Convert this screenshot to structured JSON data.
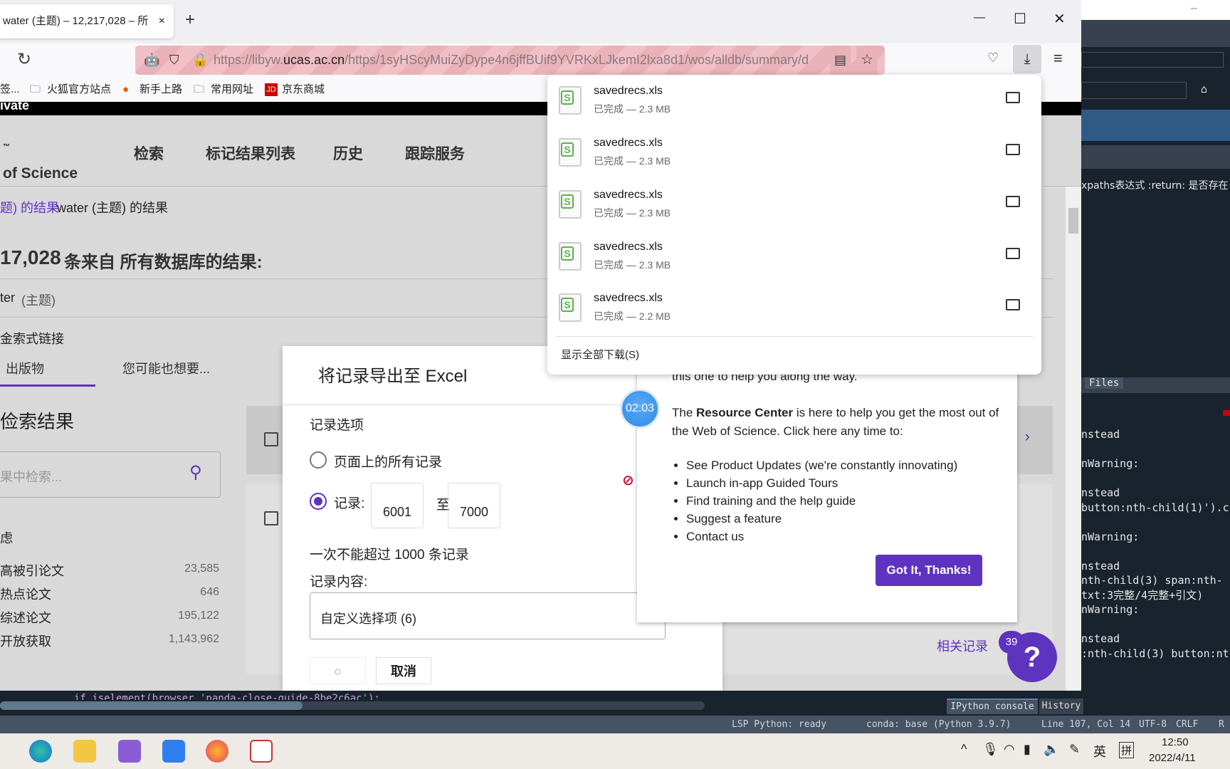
{
  "browser": {
    "tab_title": "water (主题) – 12,217,028 – 所",
    "tab_close": "×",
    "new_tab": "+",
    "url_prefix": "https://libyw.",
    "url_domain": "ucas.ac.cn",
    "url_rest": "/https/1syHScyMuiZyDype4n6jffBUif9YVRKxLJkemI2lxa8d1/wos/alldb/summary/d",
    "bookmarks": [
      "签...",
      "火狐官方站点",
      "新手上路",
      "常用网址",
      "京东商城"
    ],
    "window_controls": [
      "—",
      "☐",
      "✕"
    ]
  },
  "wos": {
    "banner_text": "ivate",
    "logo": "of Science",
    "logo_tm": "™",
    "nav": [
      "检索",
      "标记结果列表",
      "历史",
      "跟踪服务"
    ],
    "breadcrumb_link": "题) 的结果",
    "breadcrumb_current": "water (主题) 的结果",
    "results_count": "17,028",
    "results_text": "条来自 所有数据库的结果:",
    "query": "ter",
    "query_field": "(主题)",
    "query_link_label": "金索式链接",
    "tabs": [
      "出版物",
      "您可能也想要..."
    ],
    "section_title": "俭索结果",
    "search_placeholder": "果中检索...",
    "filter_heading": "虑",
    "filters": [
      {
        "label": "高被引论文",
        "count": "23,585"
      },
      {
        "label": "热点论文",
        "count": "646"
      },
      {
        "label": "综述论文",
        "count": "195,122"
      },
      {
        "label": "开放获取",
        "count": "1,143,962"
      }
    ],
    "related_records": "相关记录"
  },
  "export_modal": {
    "title": "将记录导出至 Excel",
    "record_options": "记录选项",
    "option_all": "页面上的所有记录",
    "option_range": "记录:",
    "from": "6001",
    "to_label": "至",
    "to": "7000",
    "limit_note": "一次不能超过 1000 条记录",
    "content_label": "记录内容:",
    "content_value": "自定义选择项 (6)",
    "cancel": "取消"
  },
  "downloads": {
    "items": [
      {
        "name": "savedrecs.xls",
        "status": "已完成 — 2.3 MB"
      },
      {
        "name": "savedrecs.xls",
        "status": "已完成 — 2.3 MB"
      },
      {
        "name": "savedrecs.xls",
        "status": "已完成 — 2.3 MB"
      },
      {
        "name": "savedrecs.xls",
        "status": "已完成 — 2.3 MB"
      },
      {
        "name": "savedrecs.xls",
        "status": "已完成 — 2.2 MB"
      }
    ],
    "show_all": "显示全部下载(S)"
  },
  "resource_center": {
    "timer": "02:03",
    "intro": "this one to help you along the way.",
    "p1_pre": "The ",
    "p1_bold": "Resource Center",
    "p1_post": " is here to help you get the most out of",
    "p2": "the Web of Science. Click here any time to:",
    "bullets": [
      "See Product Updates (we're constantly innovating)",
      "Launch in-app Guided Tours",
      "Find training and the help guide",
      "Suggest a feature",
      "Contact us"
    ],
    "button": "Got It, Thanks!",
    "badge": "39",
    "help": "?"
  },
  "spyder": {
    "doc_text": "xpaths表达式 :return: 是否存在",
    "files_tab": "Files",
    "console": [
      "nstead",
      "nWarning:",
      "nstead",
      "button:nth-child(1)').c",
      "nWarning:",
      "nstead",
      "nth-child(3) span:nth-",
      "txt:3完整/4完整+引文)",
      "nWarning:",
      "nstead",
      ":nth-child(3) button:nt"
    ],
    "editor_code": "if iselement(browser,'panda-close-guide-8be2c6ac'):",
    "tabs": [
      "IPython console",
      "History"
    ],
    "status": {
      "lsp": "LSP Python: ready",
      "conda": "conda: base (Python 3.9.7)",
      "position": "Line 107, Col 14",
      "encoding": "UTF-8",
      "eol": "CRLF",
      "rw": "R"
    }
  },
  "taskbar": {
    "ime_lang": "英",
    "ime_mode": "拼",
    "time": "12:50",
    "date": "2022/4/11"
  },
  "colors": {
    "accent": "#5e33bf",
    "timer": "#3d9af0",
    "spyder_bg": "#19232d",
    "status_bg": "#455364"
  }
}
